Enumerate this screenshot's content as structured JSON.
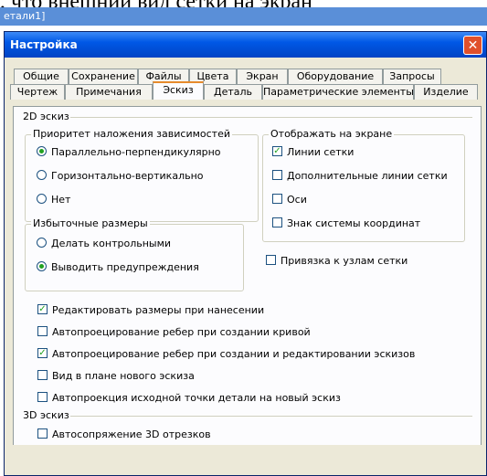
{
  "background_text": ", что внешний вид сетки на экран",
  "parent_title": "етали1]",
  "dialog": {
    "title": "Настройка"
  },
  "tabs_row1": [
    "Общие",
    "Сохранение",
    "Файлы",
    "Цвета",
    "Экран",
    "Оборудование",
    "Запросы"
  ],
  "tabs_row2": [
    "Чертеж",
    "Примечания",
    "Эскиз",
    "Деталь",
    "Параметрические элементы",
    "Изделие"
  ],
  "active_tab": "Эскиз",
  "section_2d": "2D эскиз",
  "priority": {
    "title": "Приоритет наложения зависимостей",
    "options": [
      "Параллельно-перпендикулярно",
      "Горизонтально-вертикально",
      "Нет"
    ],
    "selected": "Параллельно-перпендикулярно"
  },
  "redundant": {
    "title": "Избыточные размеры",
    "options": [
      "Делать контрольными",
      "Выводить предупреждения"
    ],
    "selected": "Выводить предупреждения"
  },
  "display": {
    "title": "Отображать на экране",
    "options": [
      {
        "label": "Линии сетки",
        "checked": true
      },
      {
        "label": "Дополнительные линии сетки",
        "checked": false
      },
      {
        "label": "Оси",
        "checked": false
      },
      {
        "label": "Знак системы координат",
        "checked": false
      }
    ]
  },
  "snap": {
    "label": "Привязка к узлам сетки",
    "checked": false
  },
  "checkboxes": [
    {
      "label": "Редактировать размеры при нанесении",
      "checked": true
    },
    {
      "label": "Автопроецирование ребер при создании кривой",
      "checked": false
    },
    {
      "label": "Автопроецирование ребер при создании и редактировании эскизов",
      "checked": true
    },
    {
      "label": "Вид в плане нового эскиза",
      "checked": false
    },
    {
      "label": "Автопроекция исходной точки детали на новый эскиз",
      "checked": false
    }
  ],
  "section_3d": "3D эскиз",
  "auto3d": {
    "label": "Автосопряжение 3D отрезков",
    "checked": false
  },
  "close_glyph": "✕",
  "check_glyph": "✓"
}
